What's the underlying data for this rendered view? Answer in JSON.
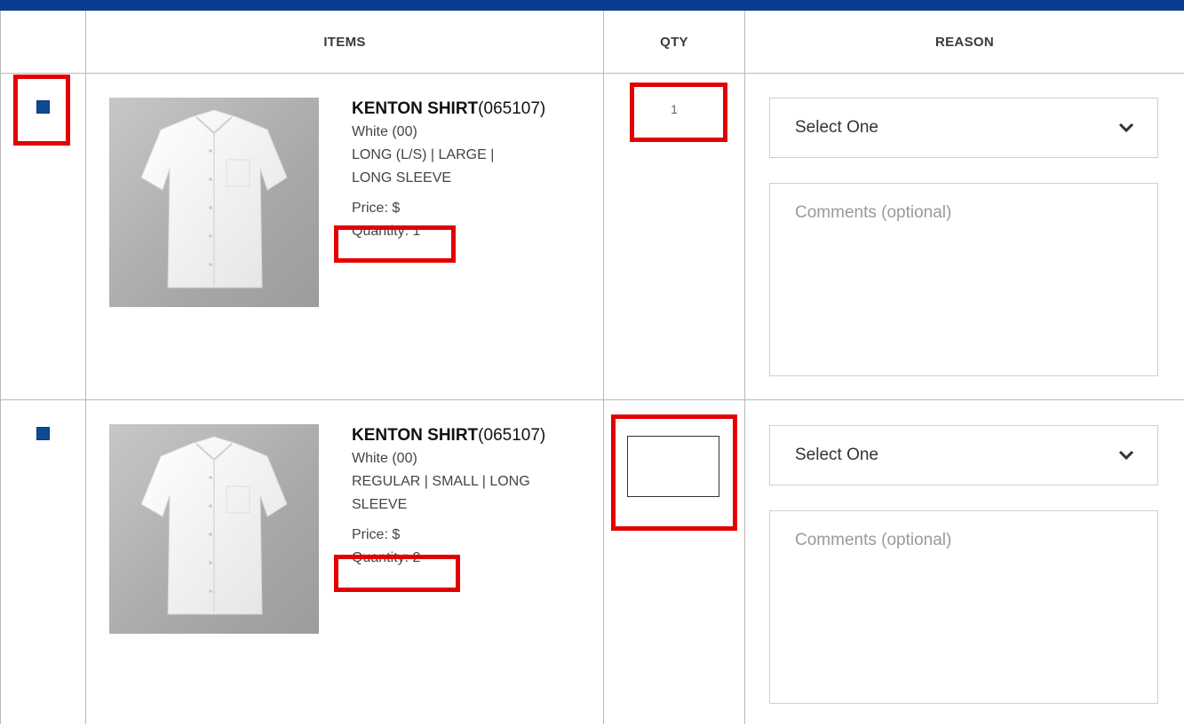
{
  "headers": {
    "items": "ITEMS",
    "qty": "QTY",
    "reason": "REASON"
  },
  "rows": [
    {
      "product_name": "KENTON SHIRT",
      "product_code": "(065107)",
      "color": "White (00)",
      "options_line1": "LONG (L/S)  |  LARGE  |",
      "options_line2": "LONG SLEEVE",
      "price": "Price: $",
      "quantity": "Quantity: 1",
      "qty_value": "1",
      "reason_placeholder": "Select One",
      "comments_placeholder": "Comments (optional)",
      "checked": true
    },
    {
      "product_name": "KENTON SHIRT",
      "product_code": "(065107)",
      "color": "White (00)",
      "options_line1": "REGULAR  |  SMALL  |  LONG",
      "options_line2": "SLEEVE",
      "price": "Price: $",
      "quantity": "Quantity: 2",
      "qty_value": "",
      "reason_placeholder": "Select One",
      "comments_placeholder": "Comments (optional)",
      "checked": true
    }
  ],
  "colors": {
    "accent": "#0a3d8f",
    "checkbox": "#0e4a93",
    "highlight": "#e30000"
  }
}
